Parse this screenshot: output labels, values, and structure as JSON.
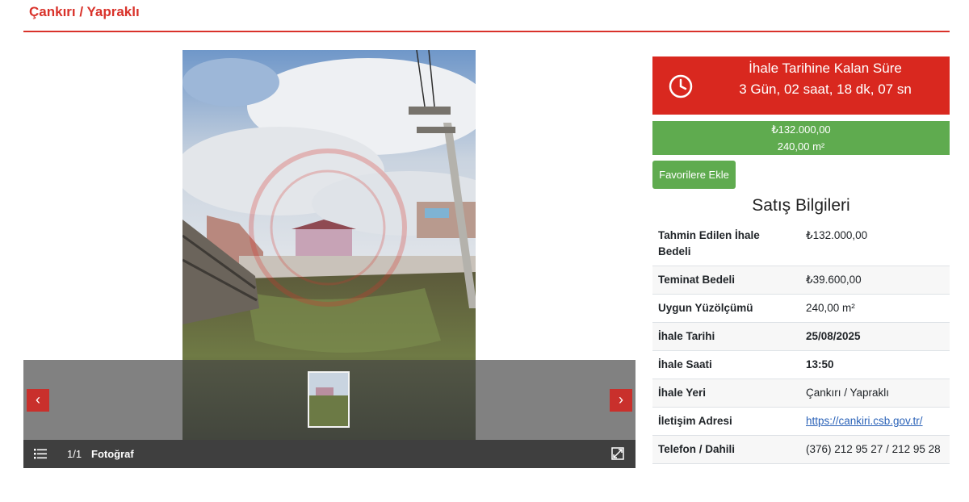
{
  "header": {
    "title": "Çankırı / Yapraklı",
    "accent_color": "#d9322a"
  },
  "gallery": {
    "counter": "1/1",
    "caption": "Fotoğraf",
    "prev_label": "‹",
    "next_label": "›",
    "icons": {
      "list": "list-icon",
      "fullscreen": "fullscreen-icon",
      "prev": "chevron-left-icon",
      "next": "chevron-right-icon"
    }
  },
  "countdown": {
    "title": "İhale Tarihine Kalan Süre",
    "time": "3 Gün, 02 saat, 18 dk, 07 sn",
    "icon": "clock-icon",
    "color": "#d9281f"
  },
  "price_box": {
    "price": "₺132.000,00",
    "area": "240,00 m²",
    "color": "#5fab4f"
  },
  "favorite_button": {
    "label": "Favorilere Ekle"
  },
  "sales_info": {
    "title": "Satış Bilgileri",
    "rows": [
      {
        "label": "Tahmin Edilen İhale Bedeli",
        "value": "₺132.000,00"
      },
      {
        "label": "Teminat Bedeli",
        "value": "₺39.600,00"
      },
      {
        "label": "Uygun Yüzölçümü",
        "value": "240,00 m²"
      },
      {
        "label": "İhale Tarihi",
        "value": "25/08/2025"
      },
      {
        "label": "İhale Saati",
        "value": "13:50"
      },
      {
        "label": "İhale Yeri",
        "value": "Çankırı / Yapraklı"
      },
      {
        "label": "İletişim Adresi",
        "value": "https://cankiri.csb.gov.tr/"
      },
      {
        "label": "Telefon / Dahili",
        "value": "(376) 212 95 27 / 212 95 28"
      }
    ]
  }
}
